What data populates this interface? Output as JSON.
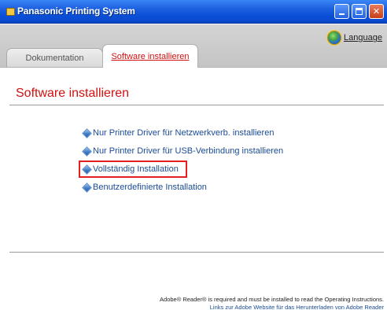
{
  "window": {
    "title": "Panasonic Printing System"
  },
  "header": {
    "language_label": "Language",
    "tabs": [
      {
        "label": "Dokumentation",
        "active": false
      },
      {
        "label": "Software installieren",
        "active": true
      }
    ]
  },
  "main": {
    "section_title": "Software installieren",
    "options": [
      {
        "label": "Nur Printer Driver für Netzwerkverb. installieren"
      },
      {
        "label": "Nur Printer Driver für USB-Verbindung installieren"
      },
      {
        "label": "Vollständig Installation",
        "highlighted": true
      },
      {
        "label": "Benutzerdefinierte Installation"
      }
    ]
  },
  "footer": {
    "note": "Adobe® Reader® is required and must be installed to read the Operating Instructions.",
    "link": "Links zur Adobe Website für das Herunterladen von Adobe Reader"
  },
  "colors": {
    "accent_red": "#d21010",
    "link_blue": "#1a4b96",
    "titlebar_blue": "#0b4fd8",
    "highlight_red": "#e31e1e"
  },
  "icons": {
    "app": "panasonic-app-icon",
    "language": "globe-icon",
    "option_bullet": "diamond-bullet-icon",
    "minimize": "minimize-icon",
    "maximize": "maximize-icon",
    "close": "close-icon"
  }
}
